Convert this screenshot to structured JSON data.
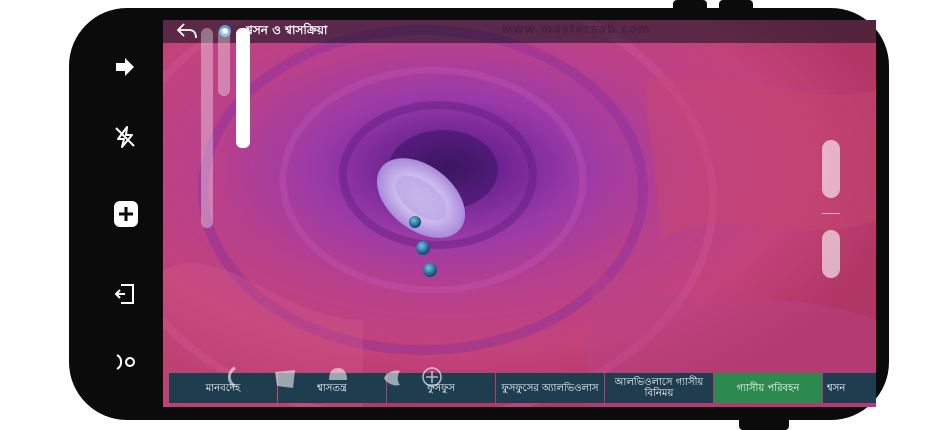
{
  "app": {
    "title": "শ্বসন ও শ্বাসক্রিয়া",
    "watermark": "www.mastersab.com"
  },
  "tabs": [
    {
      "label": "মানবদেহ",
      "active": false
    },
    {
      "label": "শ্বাসতন্ত্র",
      "active": false
    },
    {
      "label": "ফুসফুস",
      "active": false
    },
    {
      "label": "ফুসফুসের অ্যালভিওলাস",
      "active": false
    },
    {
      "label": "আলভিওলাসে গ্যাসীয় বিনিময়",
      "active": false
    },
    {
      "label": "গ্যাসীয় পরিবহন",
      "active": true
    },
    {
      "label": "শ্বসন",
      "active": false
    }
  ],
  "side_icons": [
    "arrow-right-icon",
    "lightning-icon",
    "add-icon",
    "exit-icon",
    "half-circle-icon"
  ],
  "nav_icons": [
    "back-arrow-icon",
    "home-icon",
    "recents-icon"
  ],
  "colors": {
    "tab_bg": "#1e3d4f",
    "tab_active": "#2c8a4e",
    "scene_magenta": "#b0306f",
    "scene_purple": "#7a2a9a"
  }
}
